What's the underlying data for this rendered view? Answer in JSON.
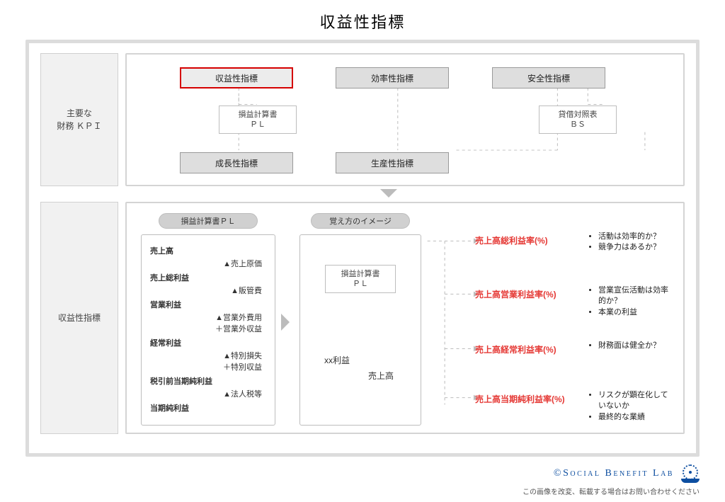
{
  "title": "収益性指標",
  "sections": {
    "kpi_label": "主要な\n財務 ＫＰＩ",
    "profit_label": "収益性指標"
  },
  "top": {
    "cats": {
      "profitability": "収益性指標",
      "efficiency": "効率性指標",
      "safety": "安全性指標",
      "growth": "成長性指標",
      "productivity": "生産性指標"
    },
    "docs": {
      "pl": "損益計算書\nＰＬ",
      "bs": "貸借対照表\nＢＳ"
    }
  },
  "pl_card": {
    "title": "損益計算書ＰＬ",
    "rows": [
      {
        "b": "売上高"
      },
      {
        "s": "▲売上原価"
      },
      {
        "b": "売上総利益"
      },
      {
        "s": "▲販管費"
      },
      {
        "b": "営業利益"
      },
      {
        "s": "▲営業外費用\n＋営業外収益"
      },
      {
        "b": "経常利益"
      },
      {
        "s": "▲特別損失\n＋特別収益"
      },
      {
        "b": "税引前当期純利益"
      },
      {
        "s": "▲法人税等"
      },
      {
        "b": "当期純利益"
      }
    ]
  },
  "image_card": {
    "title": "覚え方のイメージ",
    "box": "損益計算書\nＰＬ",
    "num": "xx利益",
    "den": "売上高"
  },
  "metrics": [
    {
      "name": "売上高総利益率(%)",
      "pts": [
        "活動は効率的か？",
        "競争力はあるか？"
      ]
    },
    {
      "name": "売上高営業利益率(%)",
      "pts": [
        "営業宣伝活動は効率的か？",
        "本業の利益"
      ]
    },
    {
      "name": "売上高経常利益率(%)",
      "pts": [
        "財務面は健全か？"
      ]
    },
    {
      "name": "売上高当期純利益率(%)",
      "pts": [
        "リスクが顕在化していないか",
        "最終的な業績"
      ]
    }
  ],
  "footer": {
    "brand": "©Social Benefit Lab",
    "note": "この画像を改変、転載する場合はお問い合わせください"
  }
}
